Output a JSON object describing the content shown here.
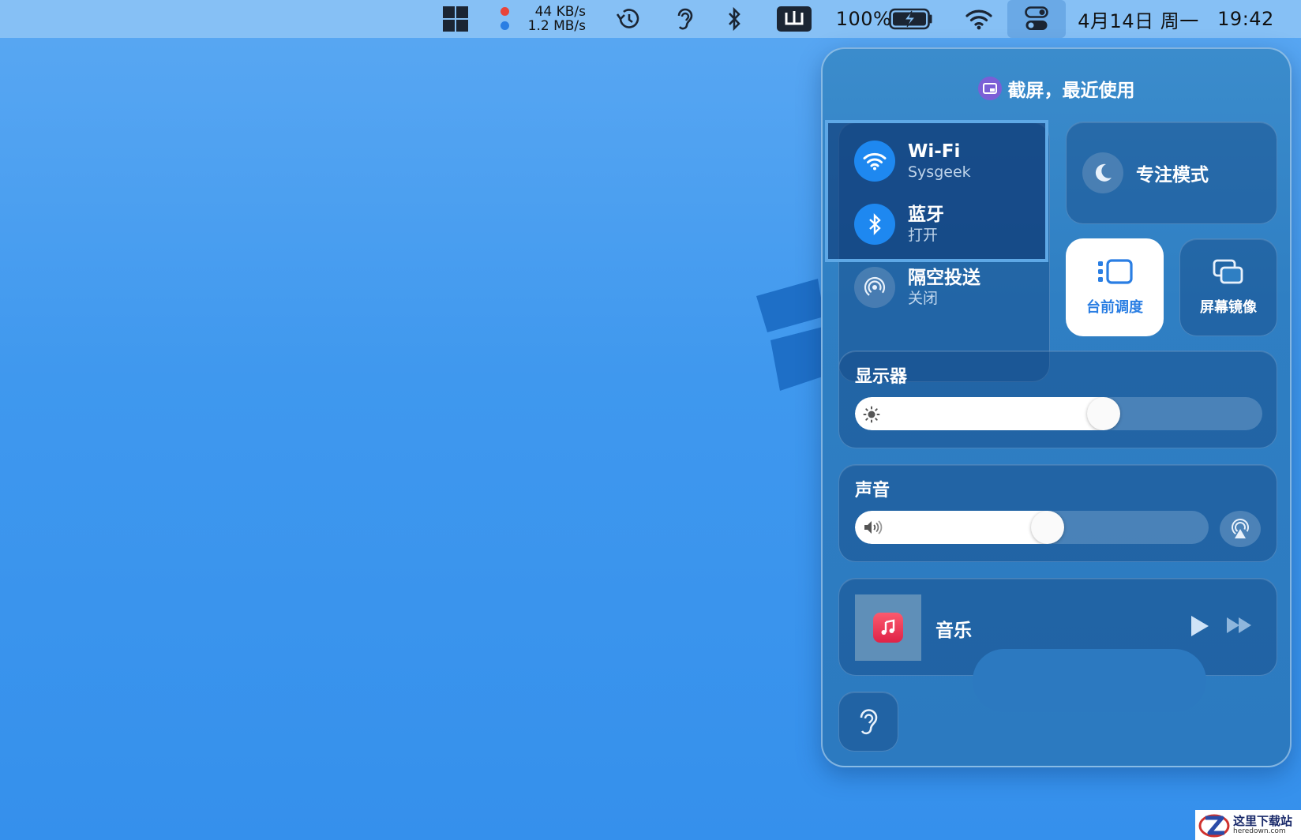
{
  "menubar": {
    "network_up": "44 KB/s",
    "network_down": "1.2 MB/s",
    "battery_percent": "100%",
    "date": "4月14日 周一",
    "time": "19:42",
    "icons": [
      "windows-icon",
      "time-machine-icon",
      "hearing-icon",
      "bluetooth-icon",
      "input-method-icon",
      "battery-charging-icon",
      "wifi-icon",
      "control-center-icon"
    ],
    "colors": {
      "upload_dot": "#e8443a",
      "download_dot": "#2a7ee3"
    }
  },
  "control_center": {
    "header": "截屏，最近使用",
    "wifi": {
      "title": "Wi-Fi",
      "status": "Sysgeek"
    },
    "bluetooth": {
      "title": "蓝牙",
      "status": "打开"
    },
    "airdrop": {
      "title": "隔空投送",
      "status": "关闭"
    },
    "focus": {
      "label": "专注模式"
    },
    "stage_manager": {
      "label": "台前调度",
      "active": true
    },
    "screen_mirroring": {
      "label": "屏幕镜像"
    },
    "display": {
      "label": "显示器",
      "brightness": 0.62
    },
    "sound": {
      "label": "声音",
      "volume": 0.55
    },
    "now_playing": {
      "label": "音乐"
    },
    "accent": "#1e88f0"
  },
  "watermark": {
    "title": "这里下载站",
    "url": "heredown.com"
  }
}
